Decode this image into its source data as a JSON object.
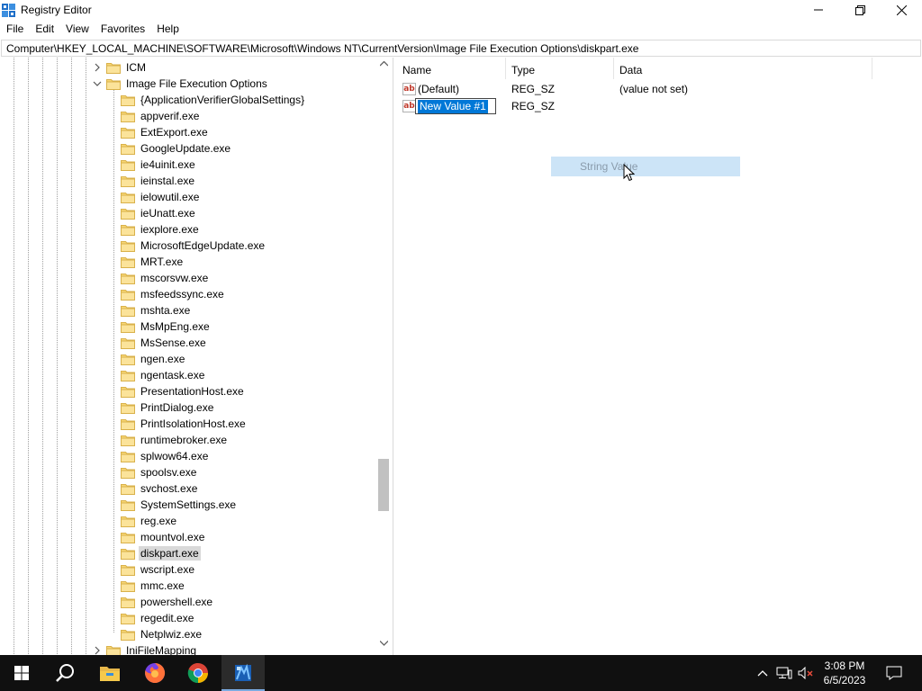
{
  "window": {
    "title": "Registry Editor"
  },
  "menu": [
    "File",
    "Edit",
    "View",
    "Favorites",
    "Help"
  ],
  "address": "Computer\\HKEY_LOCAL_MACHINE\\SOFTWARE\\Microsoft\\Windows NT\\CurrentVersion\\Image File Execution Options\\diskpart.exe",
  "tree": {
    "parent_items": [
      "ICM",
      "Image File Execution Options"
    ],
    "children": [
      "{ApplicationVerifierGlobalSettings}",
      "appverif.exe",
      "ExtExport.exe",
      "GoogleUpdate.exe",
      "ie4uinit.exe",
      "ieinstal.exe",
      "ielowutil.exe",
      "ieUnatt.exe",
      "iexplore.exe",
      "MicrosoftEdgeUpdate.exe",
      "MRT.exe",
      "mscorsvw.exe",
      "msfeedssync.exe",
      "mshta.exe",
      "MsMpEng.exe",
      "MsSense.exe",
      "ngen.exe",
      "ngentask.exe",
      "PresentationHost.exe",
      "PrintDialog.exe",
      "PrintIsolationHost.exe",
      "runtimebroker.exe",
      "splwow64.exe",
      "spoolsv.exe",
      "svchost.exe",
      "SystemSettings.exe",
      "reg.exe",
      "mountvol.exe",
      "diskpart.exe",
      "wscript.exe",
      "mmc.exe",
      "powershell.exe",
      "regedit.exe",
      "Netplwiz.exe"
    ],
    "after_item": "IniFileMapping",
    "selected": "diskpart.exe"
  },
  "values": {
    "columns": [
      "Name",
      "Type",
      "Data"
    ],
    "rows": [
      {
        "name": "(Default)",
        "type": "REG_SZ",
        "data": "(value not set)"
      },
      {
        "name": "New Value #1",
        "type": "REG_SZ",
        "data": ""
      }
    ],
    "ghost_menu_label": "String Value"
  },
  "taskbar": {
    "time": "3:08 PM",
    "date": "6/5/2023",
    "apps": [
      "start-icon",
      "search-icon",
      "file-explorer-icon",
      "firefox-icon",
      "chrome-icon",
      "regedit-icon"
    ]
  },
  "colors": {
    "selection_blue": "#0078d7",
    "taskbar_bg": "#101010",
    "ghost_highlight": "#cce4f7"
  }
}
